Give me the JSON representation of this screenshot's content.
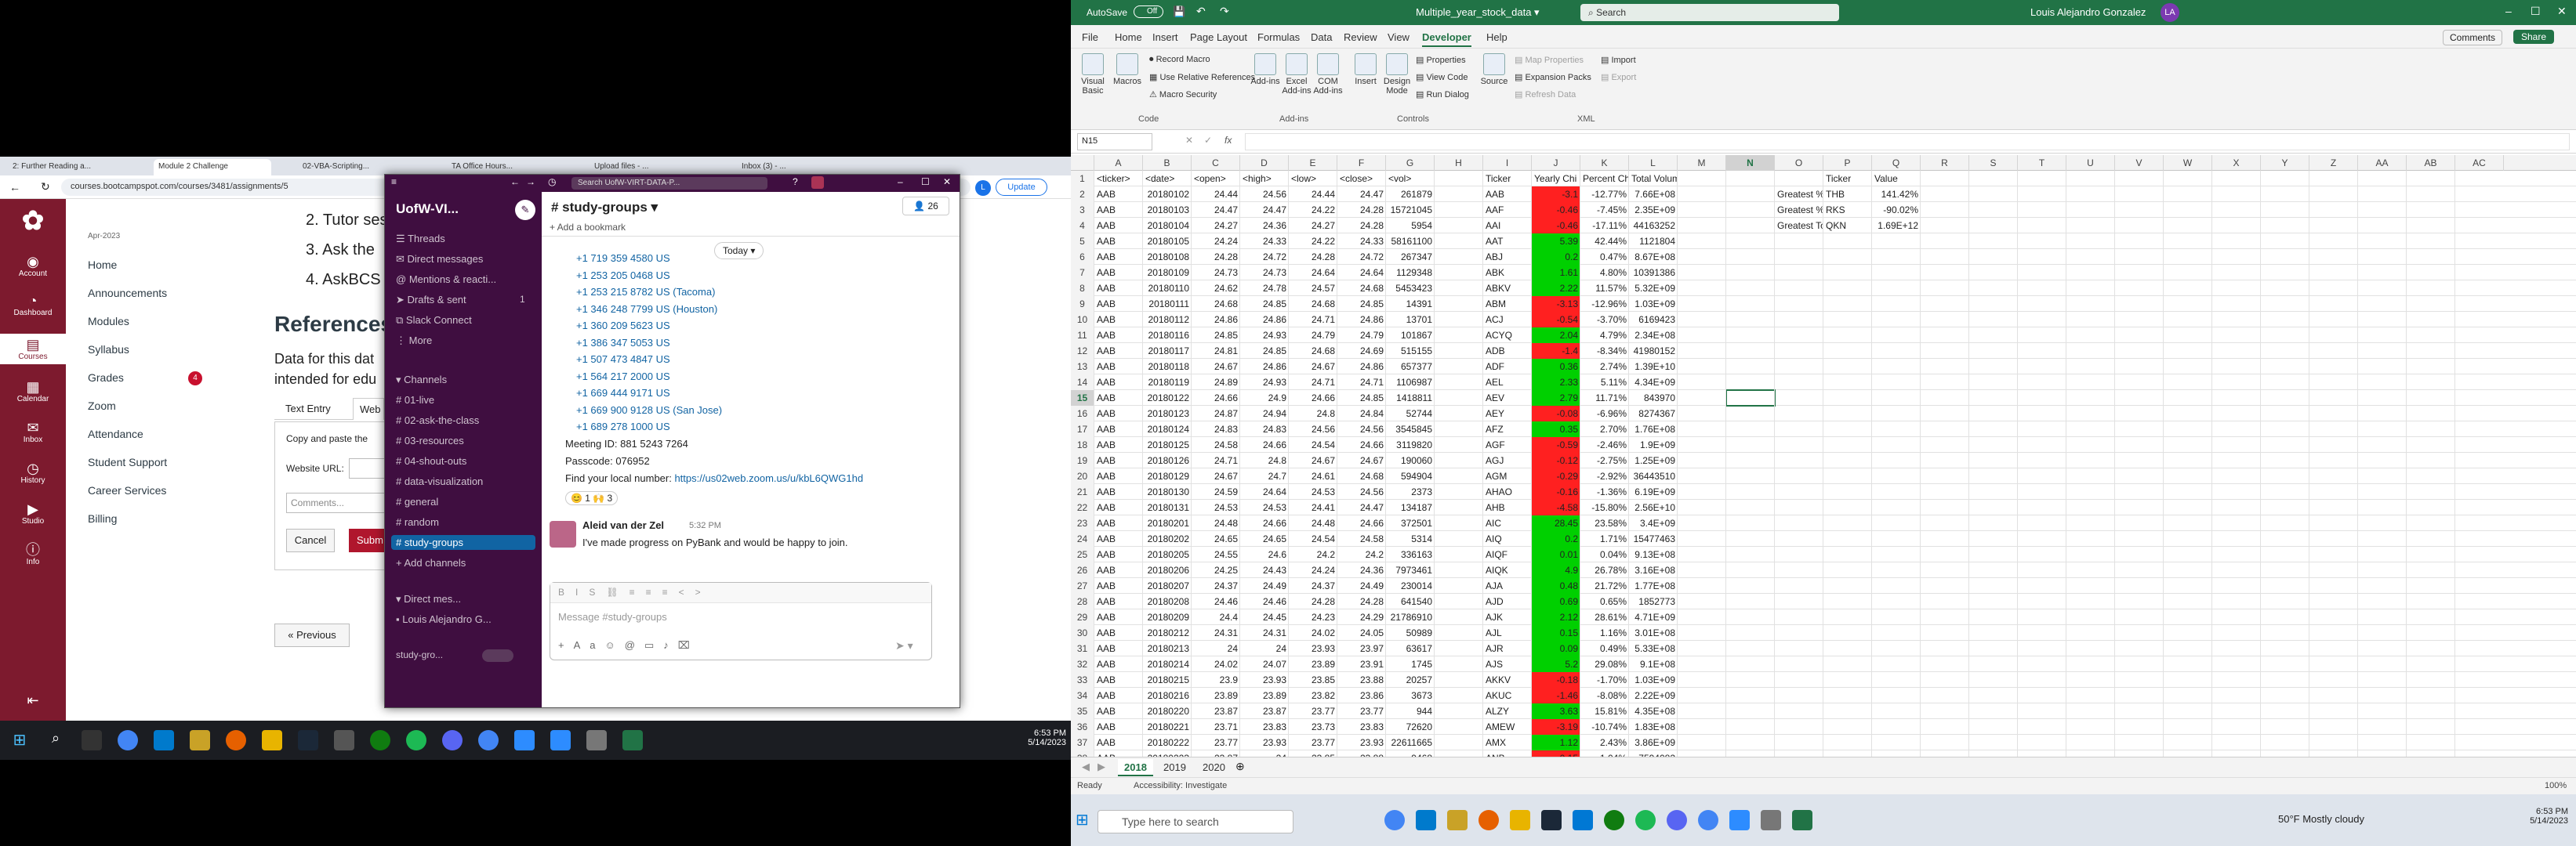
{
  "left_monitor": {
    "browser": {
      "tabs": [
        "2: Further Reading a...",
        "Module 2 Challenge",
        "02-VBA-Scripting...",
        "TA Office Hours...",
        "Upload files - ...",
        "Inbox (3) - ..."
      ],
      "url": "courses.bootcampspot.com/courses/3481/assignments/5",
      "update_label": "Update"
    },
    "canvas": {
      "global_nav": [
        "Account",
        "Dashboard",
        "Courses",
        "Calendar",
        "Inbox",
        "History",
        "Studio",
        "Info"
      ],
      "term": "Apr-2023",
      "course_nav": [
        "Home",
        "Announcements",
        "Modules",
        "Syllabus",
        "Grades",
        "Zoom",
        "Attendance",
        "Student Support",
        "Career Services",
        "Billing"
      ],
      "grades_badge": "4",
      "list_items": [
        "2. Tutor ses",
        "3. Ask the ",
        "4. AskBCS "
      ],
      "references_heading": "References",
      "data_text_1": "Data for this dat",
      "data_text_2": "intended for edu",
      "tab_text_entry": "Text Entry",
      "tab_web": "Web",
      "copy_paste": "Copy and paste the",
      "website_url_label": "Website URL:",
      "comments_placeholder": "Comments...",
      "cancel_label": "Cancel",
      "submit_label": "Subm",
      "previous_label": "« Previous"
    },
    "slack": {
      "search": "Search UofW-VIRT-DATA-P...",
      "workspace": "UofW-VI...",
      "sidebar_top": [
        "Threads",
        "Direct messages",
        "Mentions & reacti...",
        "Drafts & sent",
        "Slack Connect",
        "More"
      ],
      "drafts_count": "1",
      "channels_header": "Channels",
      "channels": [
        "01-live",
        "02-ask-the-class",
        "03-resources",
        "04-shout-outs",
        "data-visualization",
        "general",
        "random",
        "study-groups"
      ],
      "add_channels": "Add channels",
      "direct_messages_header": "Direct mes...",
      "dm_user": "Louis Alejandro G...",
      "footer_channel": "study-gro...",
      "channel_name": "# study-groups",
      "member_count": "26",
      "add_bookmark": "+ Add a bookmark",
      "today": "Today",
      "phone_lines": [
        "+1 719 359 4580 US",
        "+1 253 205 0468 US",
        "+1 253 215 8782 US (Tacoma)",
        "+1 346 248 7799 US (Houston)",
        "+1 360 209 5623 US",
        "+1 386 347 5053 US",
        "+1 507 473 4847 US",
        "+1 564 217 2000 US",
        "+1 669 444 9171 US",
        "+1 669 900 9128 US (San Jose)",
        "+1 689 278 1000 US"
      ],
      "meeting_id": "Meeting ID: 881 5243 7264",
      "passcode": "Passcode: 076952",
      "find_local": "Find your local number: ",
      "find_link": "https://us02web.zoom.us/u/kbL6QWG1hd",
      "reactions": "😊 1   🙌 3",
      "msg_author": "Aleid van der Zel",
      "msg_time": "5:32 PM",
      "msg_text": "I've made progress on PyBank and would be happy to join.",
      "composer_placeholder": "Message #study-groups"
    },
    "taskbar": {
      "time": "6:53 PM",
      "date": "5/14/2023"
    }
  },
  "excel": {
    "autosave": "AutoSave",
    "autosave_state": "Off",
    "file_title": "Multiple_year_stock_data",
    "search_placeholder": "Search",
    "user_name": "Louis Alejandro Gonzalez",
    "user_initials": "LA",
    "menu": [
      "File",
      "Home",
      "Insert",
      "Page Layout",
      "Formulas",
      "Data",
      "Review",
      "View",
      "Developer",
      "Help"
    ],
    "comments_label": "Comments",
    "share_label": "Share",
    "ribbon": {
      "code_group": "Code",
      "visual_basic": "Visual Basic",
      "macros": "Macros",
      "record_macro": "Record Macro",
      "relative_refs": "Use Relative References",
      "macro_security": "Macro Security",
      "addins_group": "Add-ins",
      "addins": "Add-ins",
      "excel_addins": "Excel Add-ins",
      "com_addins": "COM Add-ins",
      "controls_group": "Controls",
      "insert": "Insert",
      "design_mode": "Design Mode",
      "properties": "Properties",
      "view_code": "View Code",
      "run_dialog": "Run Dialog",
      "xml_group": "XML",
      "source": "Source",
      "map_properties": "Map Properties",
      "expansion_packs": "Expansion Packs",
      "refresh_data": "Refresh Data",
      "import": "Import",
      "export": "Export"
    },
    "name_box": "N15",
    "fx": "fx",
    "columns": [
      "A",
      "B",
      "C",
      "D",
      "E",
      "F",
      "G",
      "H",
      "I",
      "J",
      "K",
      "L",
      "M",
      "N",
      "O",
      "P",
      "Q",
      "R",
      "S",
      "T",
      "U",
      "V",
      "W",
      "X",
      "Y",
      "Z",
      "AA",
      "AB",
      "AC"
    ],
    "header_row": [
      "<ticker>",
      "<date>",
      "<open>",
      "<high>",
      "<low>",
      "<close>",
      "<vol>",
      "",
      "Ticker",
      "Yearly Chi",
      "Percent Ch",
      "Total Volume",
      "",
      "",
      "",
      "Ticker",
      "Value"
    ],
    "rows": [
      [
        "AAB",
        "20180102",
        "24.44",
        "24.56",
        "24.44",
        "24.47",
        "261879",
        "",
        "AAB",
        "-3.1",
        "-12.77%",
        "7.66E+08"
      ],
      [
        "AAB",
        "20180103",
        "24.47",
        "24.47",
        "24.22",
        "24.28",
        "15721045",
        "",
        "AAF",
        "-0.46",
        "-7.45%",
        "2.35E+09"
      ],
      [
        "AAB",
        "20180104",
        "24.27",
        "24.36",
        "24.27",
        "24.28",
        "5954",
        "",
        "AAI",
        "-0.46",
        "-17.11%",
        "44163252"
      ],
      [
        "AAB",
        "20180105",
        "24.24",
        "24.33",
        "24.22",
        "24.33",
        "58161100",
        "",
        "AAT",
        "5.39",
        "42.44%",
        "1121804"
      ],
      [
        "AAB",
        "20180108",
        "24.28",
        "24.72",
        "24.28",
        "24.72",
        "267347",
        "",
        "ABJ",
        "0.2",
        "0.47%",
        "8.67E+08"
      ],
      [
        "AAB",
        "20180109",
        "24.73",
        "24.73",
        "24.64",
        "24.64",
        "1129348",
        "",
        "ABK",
        "1.61",
        "4.80%",
        "10391386"
      ],
      [
        "AAB",
        "20180110",
        "24.62",
        "24.78",
        "24.57",
        "24.68",
        "5453423",
        "",
        "ABKV",
        "2.22",
        "11.57%",
        "5.32E+09"
      ],
      [
        "AAB",
        "20180111",
        "24.68",
        "24.85",
        "24.68",
        "24.85",
        "14391",
        "",
        "ABM",
        "-3.13",
        "-12.96%",
        "1.03E+09"
      ],
      [
        "AAB",
        "20180112",
        "24.86",
        "24.86",
        "24.71",
        "24.86",
        "13701",
        "",
        "ACJ",
        "-0.54",
        "-3.70%",
        "6169423"
      ],
      [
        "AAB",
        "20180116",
        "24.85",
        "24.93",
        "24.79",
        "24.79",
        "101867",
        "",
        "ACYQ",
        "2.04",
        "4.79%",
        "2.34E+08"
      ],
      [
        "AAB",
        "20180117",
        "24.81",
        "24.85",
        "24.68",
        "24.69",
        "515155",
        "",
        "ADB",
        "-1.4",
        "-8.34%",
        "41980152"
      ],
      [
        "AAB",
        "20180118",
        "24.67",
        "24.86",
        "24.67",
        "24.86",
        "657377",
        "",
        "ADF",
        "0.36",
        "2.74%",
        "1.39E+10"
      ],
      [
        "AAB",
        "20180119",
        "24.89",
        "24.93",
        "24.71",
        "24.71",
        "1106987",
        "",
        "AEL",
        "2.33",
        "5.11%",
        "4.34E+09"
      ],
      [
        "AAB",
        "20180122",
        "24.66",
        "24.9",
        "24.66",
        "24.85",
        "1418811",
        "",
        "AEV",
        "2.79",
        "11.71%",
        "843970"
      ],
      [
        "AAB",
        "20180123",
        "24.87",
        "24.94",
        "24.8",
        "24.84",
        "52744",
        "",
        "AEY",
        "-0.08",
        "-6.96%",
        "8274367"
      ],
      [
        "AAB",
        "20180124",
        "24.83",
        "24.83",
        "24.56",
        "24.56",
        "3545845",
        "",
        "AFZ",
        "0.35",
        "2.70%",
        "1.76E+08"
      ],
      [
        "AAB",
        "20180125",
        "24.58",
        "24.66",
        "24.54",
        "24.66",
        "3119820",
        "",
        "AGF",
        "-0.59",
        "-2.46%",
        "1.9E+09"
      ],
      [
        "AAB",
        "20180126",
        "24.71",
        "24.8",
        "24.67",
        "24.67",
        "190060",
        "",
        "AGJ",
        "-0.12",
        "-2.75%",
        "1.25E+09"
      ],
      [
        "AAB",
        "20180129",
        "24.67",
        "24.7",
        "24.61",
        "24.68",
        "594904",
        "",
        "AGM",
        "-0.29",
        "-2.92%",
        "36443510"
      ],
      [
        "AAB",
        "20180130",
        "24.59",
        "24.64",
        "24.53",
        "24.56",
        "2373",
        "",
        "AHAO",
        "-0.16",
        "-1.36%",
        "6.19E+09"
      ],
      [
        "AAB",
        "20180131",
        "24.53",
        "24.53",
        "24.41",
        "24.47",
        "134187",
        "",
        "AHB",
        "-4.58",
        "-15.80%",
        "2.56E+10"
      ],
      [
        "AAB",
        "20180201",
        "24.48",
        "24.66",
        "24.48",
        "24.66",
        "372501",
        "",
        "AIC",
        "28.45",
        "23.58%",
        "3.4E+09"
      ],
      [
        "AAB",
        "20180202",
        "24.65",
        "24.65",
        "24.54",
        "24.58",
        "5314",
        "",
        "AIQ",
        "0.2",
        "1.71%",
        "15477463"
      ],
      [
        "AAB",
        "20180205",
        "24.55",
        "24.6",
        "24.2",
        "24.2",
        "336163",
        "",
        "AIQF",
        "0.01",
        "0.04%",
        "9.13E+08"
      ],
      [
        "AAB",
        "20180206",
        "24.25",
        "24.43",
        "24.24",
        "24.36",
        "7973461",
        "",
        "AIQK",
        "4.9",
        "26.78%",
        "3.16E+08"
      ],
      [
        "AAB",
        "20180207",
        "24.37",
        "24.49",
        "24.37",
        "24.49",
        "230014",
        "",
        "AJA",
        "0.48",
        "21.72%",
        "1.77E+08"
      ],
      [
        "AAB",
        "20180208",
        "24.46",
        "24.46",
        "24.28",
        "24.28",
        "641540",
        "",
        "AJD",
        "0.69",
        "0.65%",
        "1852773"
      ],
      [
        "AAB",
        "20180209",
        "24.4",
        "24.45",
        "24.23",
        "24.29",
        "21786910",
        "",
        "AJK",
        "2.12",
        "28.61%",
        "4.71E+09"
      ],
      [
        "AAB",
        "20180212",
        "24.31",
        "24.31",
        "24.02",
        "24.05",
        "50989",
        "",
        "AJL",
        "0.15",
        "1.16%",
        "3.01E+08"
      ],
      [
        "AAB",
        "20180213",
        "24",
        "24",
        "23.93",
        "23.97",
        "63617",
        "",
        "AJR",
        "0.09",
        "0.49%",
        "5.33E+08"
      ],
      [
        "AAB",
        "20180214",
        "24.02",
        "24.07",
        "23.89",
        "23.91",
        "1745",
        "",
        "AJS",
        "5.2",
        "29.08%",
        "9.1E+08"
      ],
      [
        "AAB",
        "20180215",
        "23.9",
        "23.93",
        "23.85",
        "23.88",
        "20257",
        "",
        "AKKV",
        "-0.18",
        "-1.70%",
        "1.03E+09"
      ],
      [
        "AAB",
        "20180216",
        "23.89",
        "23.89",
        "23.82",
        "23.86",
        "3673",
        "",
        "AKUC",
        "-1.46",
        "-8.08%",
        "2.22E+09"
      ],
      [
        "AAB",
        "20180220",
        "23.87",
        "23.87",
        "23.77",
        "23.77",
        "944",
        "",
        "ALZY",
        "3.63",
        "15.81%",
        "4.35E+08"
      ],
      [
        "AAB",
        "20180221",
        "23.71",
        "23.83",
        "23.73",
        "23.83",
        "72620",
        "",
        "AMEW",
        "-3.19",
        "-10.74%",
        "1.83E+08"
      ],
      [
        "AAB",
        "20180222",
        "23.77",
        "23.93",
        "23.77",
        "23.93",
        "22611665",
        "",
        "AMX",
        "1.12",
        "2.43%",
        "3.86E+09"
      ],
      [
        "AAB",
        "20180223",
        "23.87",
        "24",
        "23.85",
        "23.88",
        "9468",
        "",
        "ANB",
        "-0.15",
        "-1.04%",
        "7594082"
      ]
    ],
    "summary": [
      [
        "Greatest % Increase",
        "THB",
        "141.42%"
      ],
      [
        "Greatest % Decrease",
        "RKS",
        "-90.02%"
      ],
      [
        "Greatest Total Volume",
        "QKN",
        "1.69E+12"
      ]
    ],
    "sheets": [
      "2018",
      "2019",
      "2020"
    ],
    "status": {
      "ready": "Ready",
      "accessibility": "Accessibility: Investigate",
      "zoom": "100%"
    },
    "taskbar": {
      "search": "Type here to search",
      "weather": "50°F  Mostly cloudy",
      "time": "6:53 PM",
      "date": "5/14/2023"
    },
    "colors": {
      "green": "#217346",
      "pos": "#00d000",
      "neg": "#ff2020"
    }
  }
}
